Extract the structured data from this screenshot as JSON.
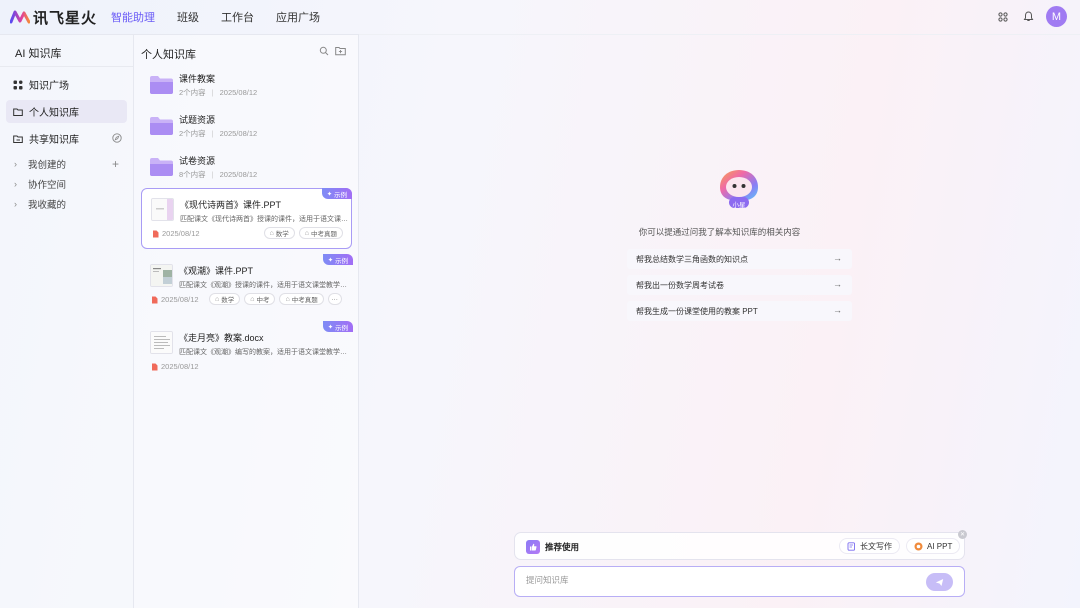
{
  "app": {
    "name": "讯飞星火"
  },
  "nav": [
    {
      "label": "智能助理",
      "active": true
    },
    {
      "label": "班级",
      "active": false
    },
    {
      "label": "工作台",
      "active": false
    },
    {
      "label": "应用广场",
      "active": false
    }
  ],
  "header": {
    "icons": [
      "grid-icon",
      "bell-icon"
    ],
    "avatar_letter": "M"
  },
  "sidebar": {
    "title": "AI 知识库",
    "items": [
      {
        "label": "知识广场",
        "icon": "grid-icon"
      },
      {
        "label": "个人知识库",
        "icon": "folder-icon",
        "active": true
      },
      {
        "label": "共享知识库",
        "icon": "share-folder-icon"
      }
    ],
    "sub_items": [
      {
        "label": "我创建的"
      },
      {
        "label": "协作空间"
      },
      {
        "label": "我收藏的"
      }
    ]
  },
  "panel": {
    "title": "个人知识库",
    "folders": [
      {
        "name": "课件教案",
        "count": "2个内容",
        "date": "2025/08/12"
      },
      {
        "name": "试题资源",
        "count": "2个内容",
        "date": "2025/08/12"
      },
      {
        "name": "试卷资源",
        "count": "8个内容",
        "date": "2025/08/12"
      }
    ],
    "files": [
      {
        "title": "《现代诗两首》课件.PPT",
        "desc": "匹配课文《现代诗两首》授课的课件，适用于语文课堂教学",
        "date": "2025/08/12",
        "badge": "示例",
        "tags": [
          "数学",
          "中考真题"
        ]
      },
      {
        "title": "《观潮》课件.PPT",
        "desc": "匹配课文《观潮》授课的课件，适用于语文课堂教学，帮助学生理解",
        "date": "2025/08/12",
        "badge": "示例",
        "tags": [
          "数学",
          "中考",
          "中考真题"
        ],
        "more": "···"
      },
      {
        "title": "《走月亮》教案.docx",
        "desc": "匹配课文《观潮》编写的教案，适用于语文课堂教学，帮助学生理解",
        "date": "2025/08/12",
        "badge": "示例",
        "tags": []
      }
    ]
  },
  "main": {
    "mascot_label": "小星",
    "hint": "你可以提通过问我了解本知识库的相关内容",
    "suggestions": [
      "帮我总结数学三角函数的知识点",
      "帮我出一份数学周考试卷",
      "帮我生成一份课堂使用的教案 PPT"
    ],
    "recommend": {
      "label": "推荐使用",
      "buttons": [
        "长文写作",
        "AI PPT"
      ]
    },
    "input_placeholder": "提问知识库"
  },
  "colors": {
    "accent": "#6b5cf6",
    "selected_border": "#a99cf5",
    "badge": "#8f7cf5"
  }
}
